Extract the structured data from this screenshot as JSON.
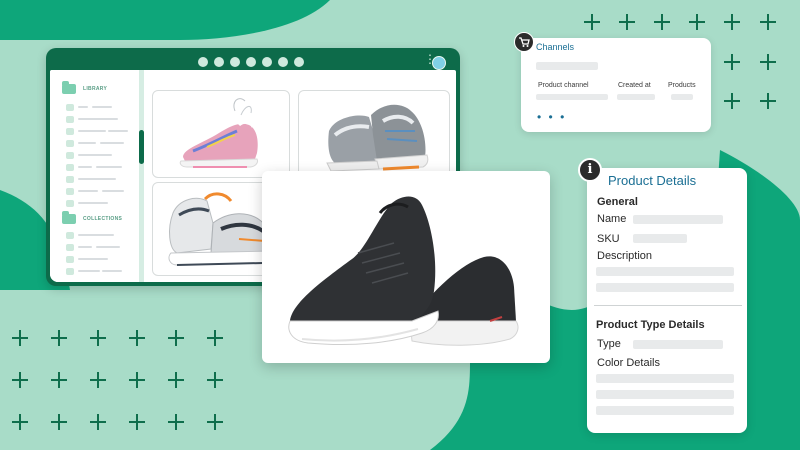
{
  "window": {
    "title": ""
  },
  "sidebar": {
    "sections": [
      {
        "label": "LIBRARY"
      },
      {
        "label": "COLLECTIONS"
      }
    ]
  },
  "gallery": {
    "items": [
      {
        "icon": "pink-sneaker-image"
      },
      {
        "icon": "gray-sneaker-image"
      },
      {
        "icon": "white-orange-sneaker-image"
      },
      {
        "icon": "black-knit-sneaker-image"
      }
    ]
  },
  "channels": {
    "title": "Channels",
    "columns": [
      "Product channel",
      "Created at",
      "Products"
    ],
    "more": "• • •"
  },
  "details": {
    "title": "Product Details",
    "general_heading": "General",
    "fields": [
      "Name",
      "SKU",
      "Description"
    ],
    "type_heading": "Product Type Details",
    "type_fields": [
      "Type",
      "Color Details"
    ]
  },
  "colors": {
    "brand_green": "#0d6b4a",
    "accent_green": "#0ea67a",
    "mint_bg": "#a8dcc8",
    "title_blue": "#1b6f94"
  }
}
